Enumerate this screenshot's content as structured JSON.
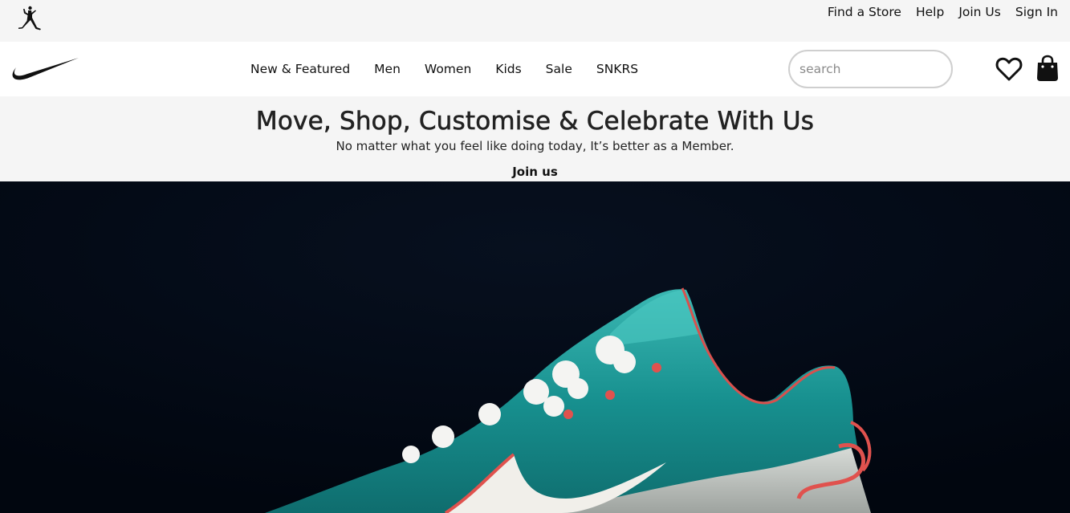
{
  "utility_bar": {
    "logo_icon": "jordan-jumpman-icon",
    "links": [
      "Find a Store",
      "Help",
      "Join Us",
      "Sign In"
    ]
  },
  "main_nav": {
    "logo_icon": "nike-swoosh-icon",
    "menu": [
      "New & Featured",
      "Men",
      "Women",
      "Kids",
      "Sale",
      "SNKRS"
    ],
    "search": {
      "placeholder": "search",
      "value": ""
    },
    "icons": [
      "heart-icon",
      "shopping-bag-icon"
    ]
  },
  "member_banner": {
    "title": "Move, Shop, Customise & Celebrate With Us",
    "subtitle": "No matter what you feel like doing today, It’s better as a Member.",
    "cta": "Join us"
  },
  "hero": {
    "image": "teal sneaker with fluffy white laces on dark background"
  },
  "colors": {
    "util_bg": "#f5f5f5",
    "hero_bg": "#020816",
    "shoe_teal": "#1f9e9c",
    "shoe_red": "#e0524e"
  }
}
